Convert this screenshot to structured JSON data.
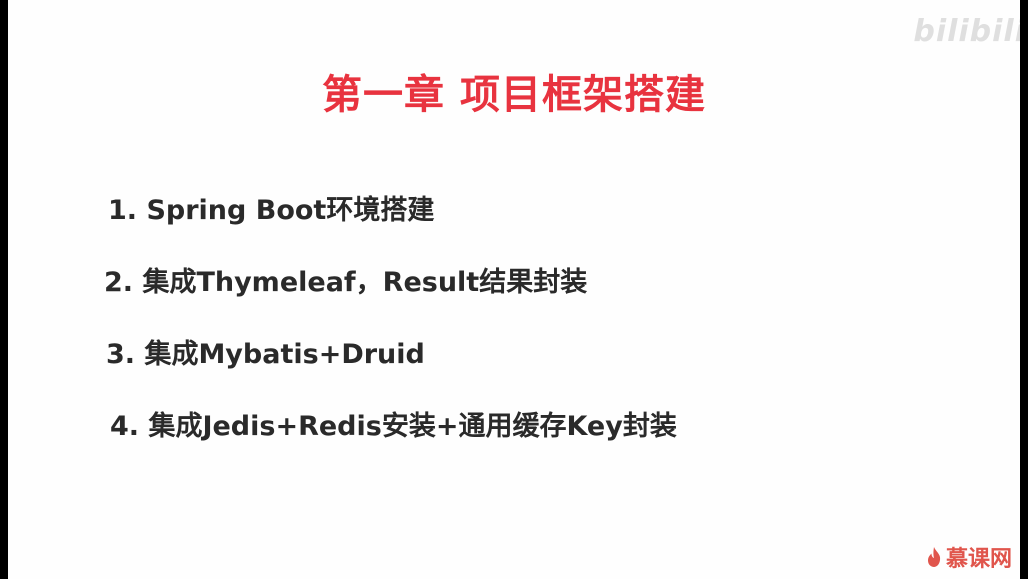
{
  "slide": {
    "title": "第一章 项目框架搭建",
    "items": [
      "1. Spring Boot环境搭建",
      "2. 集成Thymeleaf，Result结果封装",
      "3. 集成Mybatis+Druid",
      "4. 集成Jedis+Redis安装+通用缓存Key封装"
    ]
  },
  "watermarks": {
    "top": "bilibili",
    "bottom": "慕课网",
    "bottom_icon": "flame-icon"
  },
  "colors": {
    "title": "#e8333f",
    "text": "#2a2a2a",
    "background": "#fefefe",
    "frame": "#000000"
  }
}
